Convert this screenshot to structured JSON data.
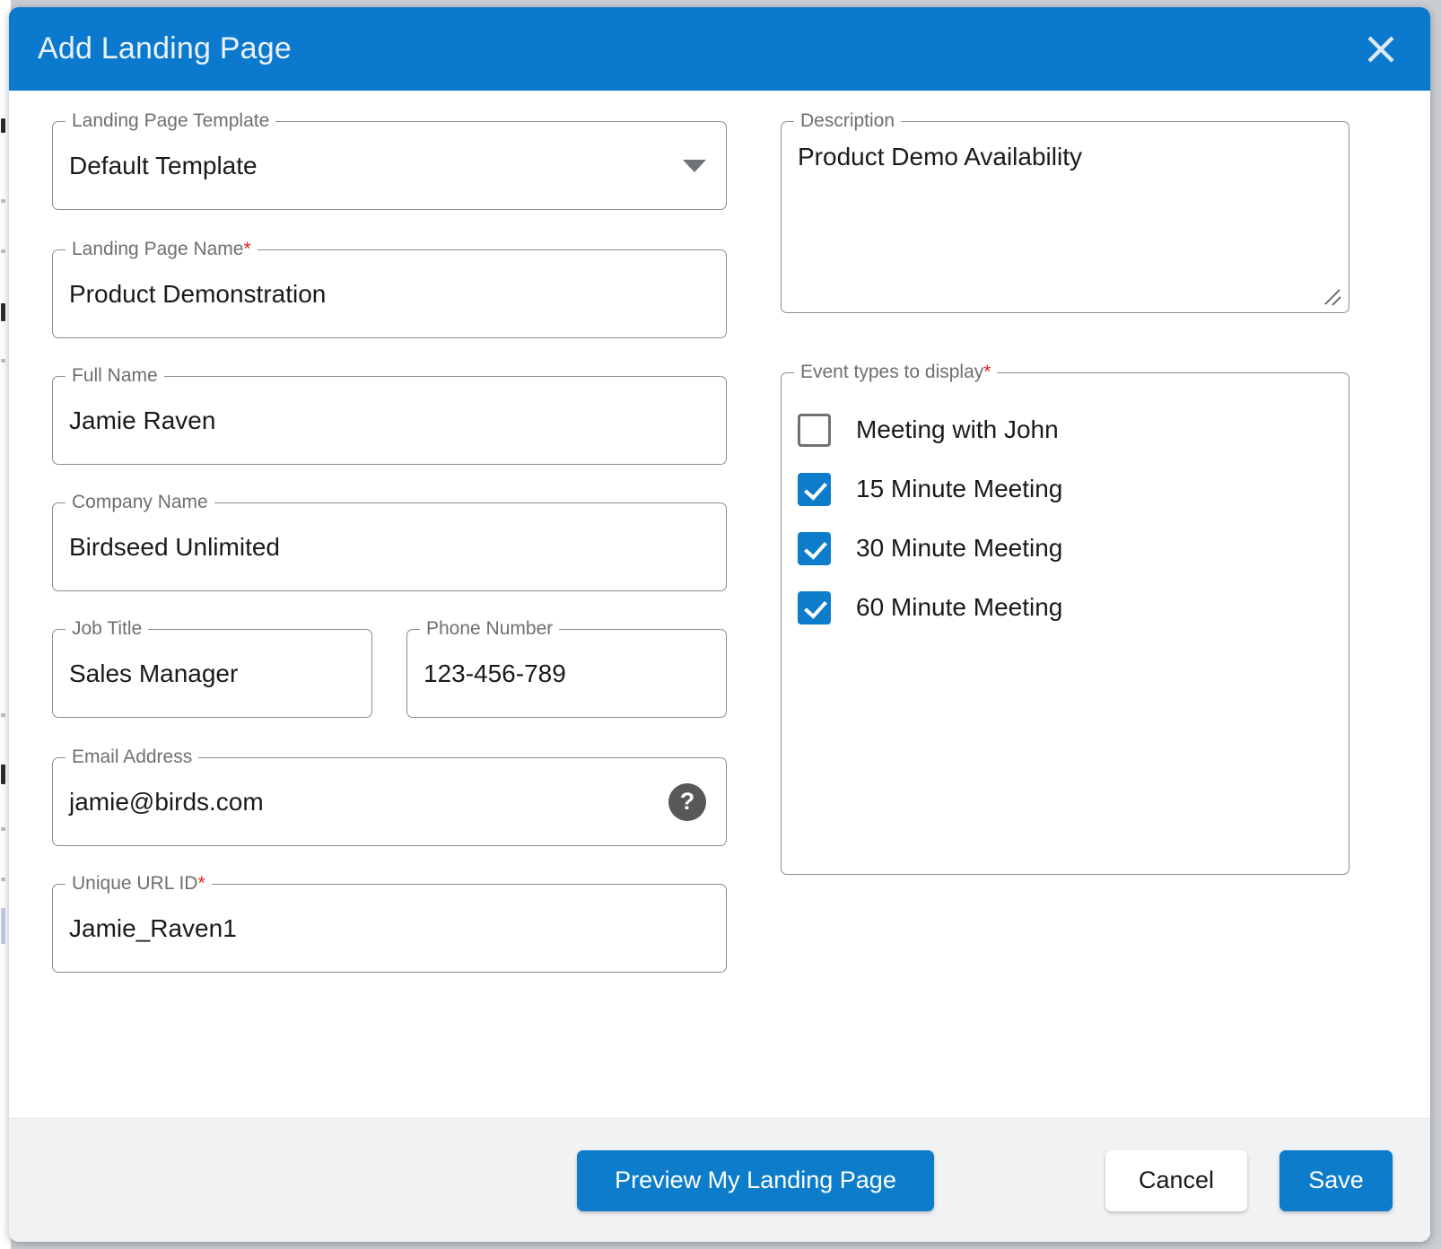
{
  "dialog": {
    "title": "Add Landing Page",
    "close_icon": "close-icon"
  },
  "left_column": {
    "template": {
      "label": "Landing Page Template",
      "value": "Default Template",
      "required": false,
      "caret_icon": "chevron-down-icon"
    },
    "page_name": {
      "label": "Landing Page Name",
      "required_marker": "*",
      "value": "Product Demonstration"
    },
    "full_name": {
      "label": "Full Name",
      "value": "Jamie Raven"
    },
    "company_name": {
      "label": "Company Name",
      "value": "Birdseed Unlimited"
    },
    "job_title": {
      "label": "Job Title",
      "value": "Sales Manager"
    },
    "phone_number": {
      "label": "Phone Number",
      "value": "123-456-789"
    },
    "email_address": {
      "label": "Email Address",
      "value": "jamie@birds.com",
      "help_icon": "question-mark-icon",
      "help_glyph": "?"
    },
    "unique_url_id": {
      "label": "Unique URL ID",
      "required_marker": "*",
      "value": "Jamie_Raven1"
    }
  },
  "right_column": {
    "description": {
      "label": "Description",
      "value": "Product Demo Availability",
      "resize_handle_icon": "resize-grip-icon"
    },
    "event_types": {
      "label": "Event types to display",
      "required_marker": "*",
      "options": [
        {
          "label": "Meeting with John",
          "checked": false
        },
        {
          "label": "15 Minute Meeting",
          "checked": true
        },
        {
          "label": "30 Minute Meeting",
          "checked": true
        },
        {
          "label": "60 Minute Meeting",
          "checked": true
        }
      ]
    }
  },
  "footer": {
    "preview_label": "Preview My Landing Page",
    "cancel_label": "Cancel",
    "save_label": "Save"
  },
  "colors": {
    "header_blue": "#0b7ace",
    "accent_blue": "#0c7ccb",
    "required_red": "#e02020",
    "field_border": "#8a8d91",
    "label_gray": "#6d6f73",
    "footer_bg": "#f1f2f4",
    "help_icon_gray": "#58585a",
    "backdrop": "#c9ccd1"
  }
}
